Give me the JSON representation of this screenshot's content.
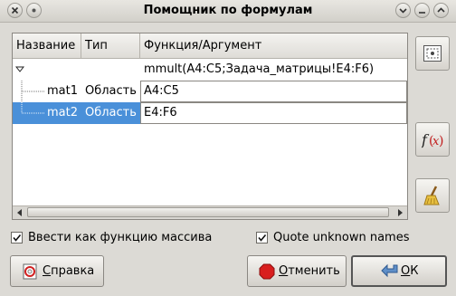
{
  "window": {
    "title": "Помощник по формулам"
  },
  "table": {
    "columns": [
      "Название",
      "Тип",
      "Функция/Аргумент"
    ],
    "root": {
      "formula": "mmult(A4:C5;Задача_матрицы!E4:F6)"
    },
    "rows": [
      {
        "name": "mat1",
        "type": "Область",
        "value": "A4:C5",
        "selected": false
      },
      {
        "name": "mat2",
        "type": "Область",
        "value": "E4:F6",
        "selected": true
      }
    ]
  },
  "options": {
    "array_label": "Ввести как функцию массива",
    "array_checked": true,
    "quote_label": "Quote unknown names",
    "quote_checked": true
  },
  "buttons": {
    "help_accel": "С",
    "help_rest": "правка",
    "cancel_accel": "О",
    "cancel_rest": "тменить",
    "ok_accel": "О",
    "ok_rest": "К"
  },
  "colors": {
    "selection": "#4a90d9",
    "cancel_icon": "#d81e1e"
  },
  "icons": [
    "close-icon",
    "minimize-icon",
    "maximize-icon",
    "select-range-icon",
    "function-icon",
    "clear-icon",
    "help-icon",
    "stop-icon",
    "ok-arrow-icon"
  ]
}
